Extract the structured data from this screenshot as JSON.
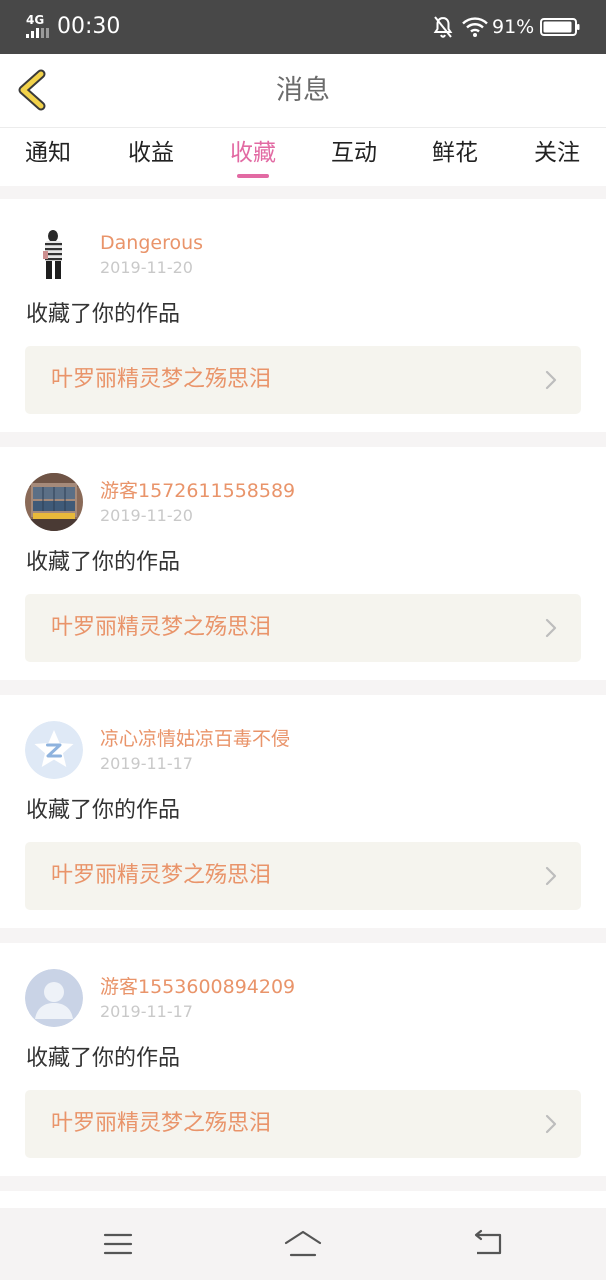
{
  "status_bar": {
    "network": "4G",
    "time": "00:30",
    "battery_percent": "91%",
    "icons": [
      "signal-icon",
      "bell-muted-icon",
      "wifi-icon",
      "battery-icon"
    ]
  },
  "header": {
    "title": "消息",
    "back_icon": "chevron-left-icon",
    "accent_color": "#f2d24a"
  },
  "tabs": [
    {
      "label": "通知",
      "active": false
    },
    {
      "label": "收益",
      "active": false
    },
    {
      "label": "收藏",
      "active": true
    },
    {
      "label": "互动",
      "active": false
    },
    {
      "label": "鲜花",
      "active": false
    },
    {
      "label": "关注",
      "active": false
    }
  ],
  "colors": {
    "active_tab": "#e26aa3",
    "name_text": "#e9946a",
    "work_box_bg": "#f5f4ee"
  },
  "messages": [
    {
      "user_name": "Dangerous",
      "date": "2019-11-20",
      "text": "收藏了你的作品",
      "work_title": "叶罗丽精灵梦之殇思泪",
      "avatar": "photo-person-avatar"
    },
    {
      "user_name": "游客1572611558589",
      "date": "2019-11-20",
      "text": "收藏了你的作品",
      "work_title": "叶罗丽精灵梦之殇思泪",
      "avatar": "photo-building-avatar"
    },
    {
      "user_name": "凉心凉情姑凉百毒不侵",
      "date": "2019-11-17",
      "text": "收藏了你的作品",
      "work_title": "叶罗丽精灵梦之殇思泪",
      "avatar": "qq-star-avatar"
    },
    {
      "user_name": "游客1553600894209",
      "date": "2019-11-17",
      "text": "收藏了你的作品",
      "work_title": "叶罗丽精灵梦之殇思泪",
      "avatar": "default-user-avatar"
    }
  ],
  "bottom_nav": {
    "items": [
      "menu-icon",
      "home-icon",
      "back-icon"
    ]
  }
}
